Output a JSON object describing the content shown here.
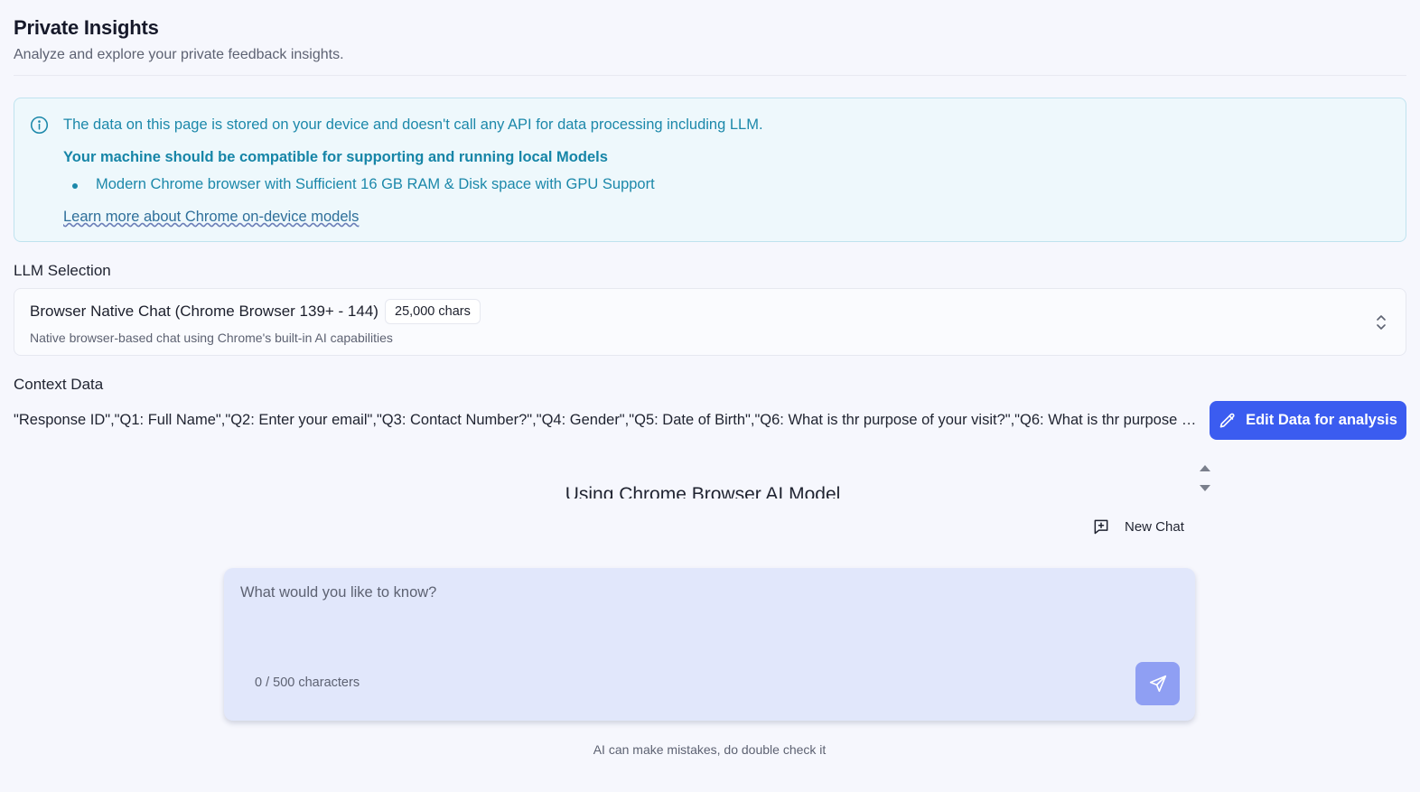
{
  "header": {
    "title": "Private Insights",
    "subtitle": "Analyze and explore your private feedback insights."
  },
  "info": {
    "icon": "info-icon",
    "line1": "The data on this page is stored on your device and doesn't call any API for data processing including LLM.",
    "line2": "Your machine should be compatible for supporting and running local Models",
    "bullet": "Modern Chrome browser with Sufficient 16 GB RAM & Disk space with GPU Support",
    "link": "Learn more about Chrome on-device models",
    "color": "#1c88aa"
  },
  "llm": {
    "label": "LLM Selection",
    "selected_name": "Browser Native Chat (Chrome Browser 139+ - 144)",
    "chip": "25,000 chars",
    "description": "Native browser-based chat using Chrome's built-in AI capabilities"
  },
  "context": {
    "label": "Context Data",
    "text": "\"Response ID\",\"Q1: Full Name\",\"Q2: Enter your email\",\"Q3: Contact Number?\",\"Q4: Gender\",\"Q5: Date of Birth\",\"Q6: What is thr purpose of your visit?\",\"Q6: What is thr purpose o...",
    "edit_button": "Edit Data for analysis",
    "accent": "#3b5cf0"
  },
  "chat": {
    "heading": "Using Chrome Browser AI Model",
    "new_chat": "New Chat",
    "placeholder": "What would you like to know?",
    "char_count": "0 / 500 characters",
    "disclaimer": "AI can make mistakes, do double check it"
  }
}
